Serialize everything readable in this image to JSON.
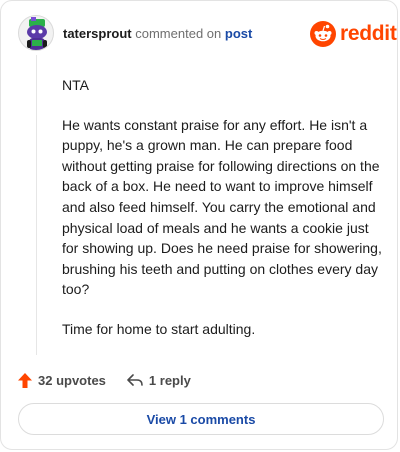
{
  "comment": {
    "author": "tatersprout",
    "action_text": "commented on",
    "target_text": "post",
    "paragraphs": [
      "NTA",
      "He wants constant praise for any effort. He isn't a puppy, he's a grown man. He can prepare food without getting praise for following directions on the back of a box. He need to want to improve himself and also feed himself. You carry the emotional and physical load of meals and he wants a cookie just for showing up. Does he need praise for showering, brushing his teeth and putting on clothes every day too?",
      "Time for home to start adulting."
    ]
  },
  "brand": {
    "name": "reddit",
    "color": "#ff4500"
  },
  "actions": {
    "upvotes_label": "32 upvotes",
    "reply_label": "1 reply"
  },
  "view_comments_label": "View 1 comments",
  "icons": {
    "avatar": "snoo-avatar",
    "upvote": "upvote-arrow-icon",
    "reply": "reply-arrow-icon",
    "logo": "reddit-logo-icon"
  },
  "colors": {
    "link": "#1a4aa6",
    "upvote": "#ff4500",
    "text": "#1c1c1c"
  }
}
